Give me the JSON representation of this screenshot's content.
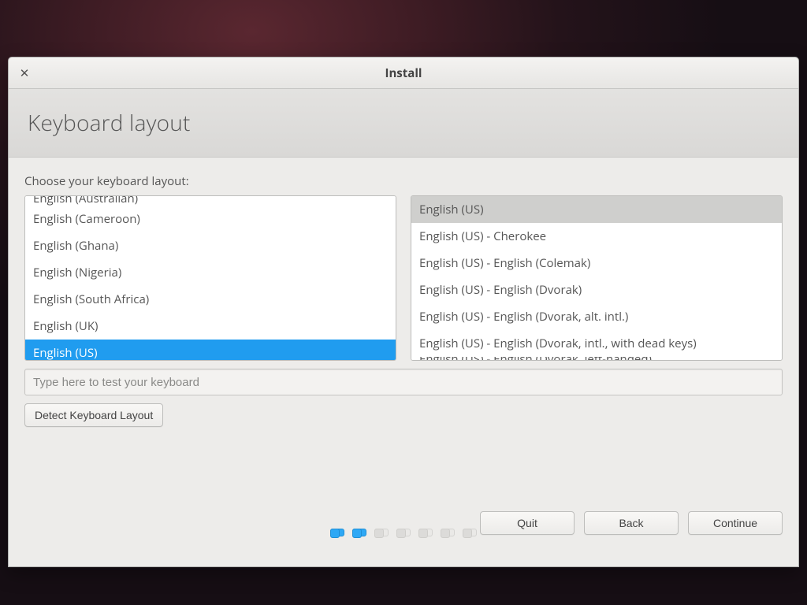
{
  "window": {
    "title": "Install"
  },
  "header": {
    "heading": "Keyboard layout"
  },
  "subtitle": "Choose your keyboard layout:",
  "layout_list": {
    "items": [
      "English (Australian)",
      "English (Cameroon)",
      "English (Ghana)",
      "English (Nigeria)",
      "English (South Africa)",
      "English (UK)",
      "English (US)"
    ],
    "selected_index": 6
  },
  "variant_list": {
    "items": [
      "English (US)",
      "English (US) - Cherokee",
      "English (US) - English (Colemak)",
      "English (US) - English (Dvorak)",
      "English (US) - English (Dvorak, alt. intl.)",
      "English (US) - English (Dvorak, intl., with dead keys)",
      "English (US) - English (Dvorak, left-handed)"
    ],
    "selected_index": 0
  },
  "test_input": {
    "placeholder": "Type here to test your keyboard",
    "value": ""
  },
  "buttons": {
    "detect": "Detect Keyboard Layout",
    "quit": "Quit",
    "back": "Back",
    "continue": "Continue"
  },
  "progress": {
    "total": 7,
    "active": [
      0,
      1
    ]
  }
}
